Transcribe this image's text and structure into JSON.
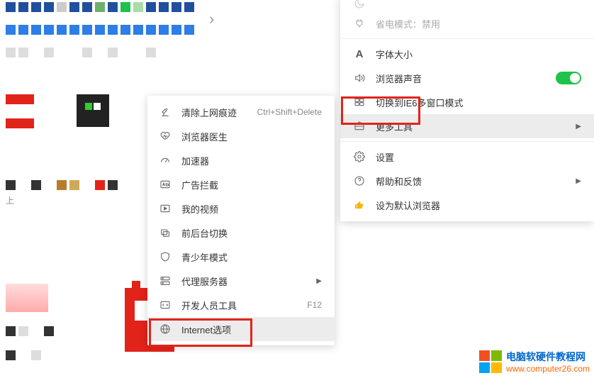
{
  "left_menu": {
    "clear_traces": {
      "label": "清除上网痕迹",
      "shortcut": "Ctrl+Shift+Delete"
    },
    "browser_doctor": {
      "label": "浏览器医生"
    },
    "accelerator": {
      "label": "加速器"
    },
    "ad_block": {
      "label": "广告拦截"
    },
    "my_videos": {
      "label": "我的视频"
    },
    "switch_fg_bg": {
      "label": "前后台切换"
    },
    "youth_mode": {
      "label": "青少年模式"
    },
    "proxy_server": {
      "label": "代理服务器"
    },
    "dev_tools": {
      "label": "开发人员工具",
      "shortcut": "F12"
    },
    "internet_options": {
      "label": "Internet选项"
    }
  },
  "right_menu": {
    "night_mode_partial": {
      "label": "夜间模式"
    },
    "power_saving": {
      "label": "省电模式：",
      "status": "禁用"
    },
    "font_size": {
      "label": "字体大小"
    },
    "browser_sound": {
      "label": "浏览器声音"
    },
    "switch_ie6": {
      "label": "切换到IE6多窗口模式"
    },
    "more_tools": {
      "label": "更多工具"
    },
    "settings": {
      "label": "设置"
    },
    "help_feedback": {
      "label": "帮助和反馈"
    },
    "set_default": {
      "label": "设为默认浏览器"
    }
  },
  "watermark": {
    "line1": "电脑软硬件教程网",
    "line2": "www.computer26.com"
  }
}
